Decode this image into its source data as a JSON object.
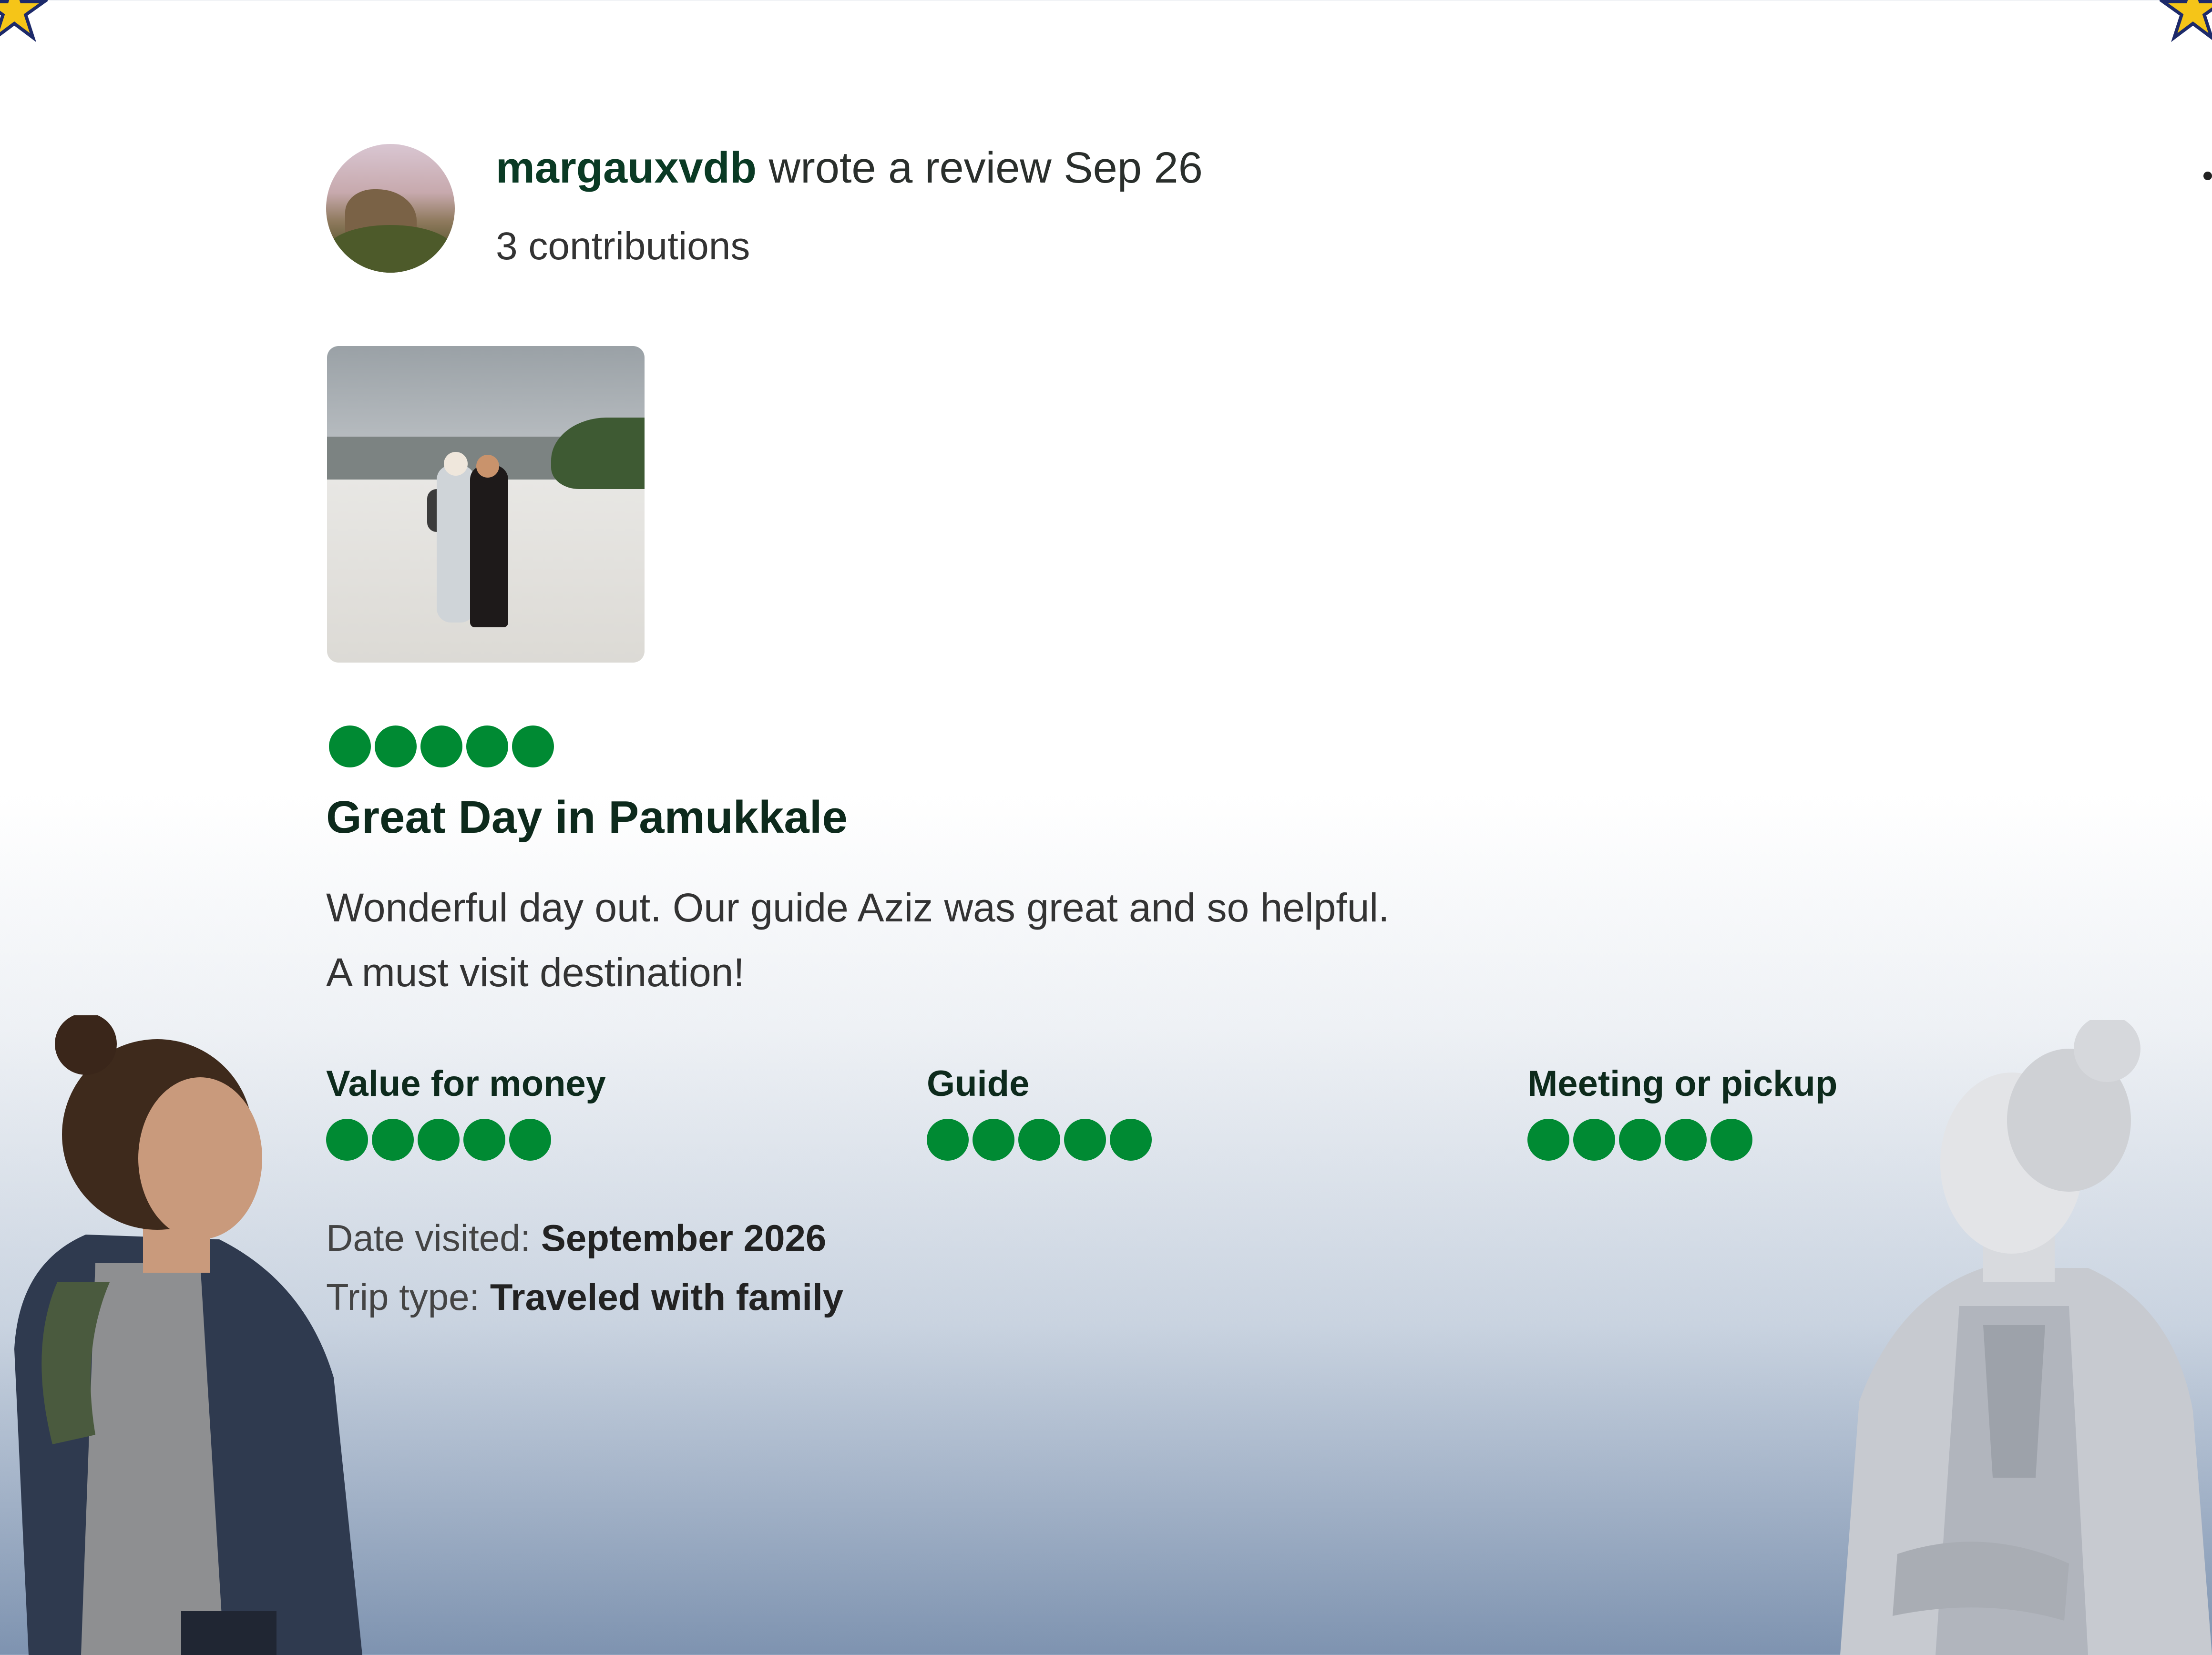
{
  "review": {
    "username": "margauxvdb",
    "action_text": "wrote a review Sep 26",
    "contributions": "3 contributions",
    "rating": 5,
    "title": "Great Day in Pamukkale",
    "body_lines": [
      "Wonderful day out. Our guide Aziz was great and so helpful.",
      "A must visit destination!"
    ],
    "subratings": [
      {
        "label": "Value for money",
        "rating": 5
      },
      {
        "label": "Guide",
        "rating": 5
      },
      {
        "label": "Meeting or pickup",
        "rating": 5
      }
    ],
    "date_visited_label": "Date visited:",
    "date_visited_value": "September 2026",
    "trip_type_label": "Trip type:",
    "trip_type_value": "Traveled with family"
  },
  "colors": {
    "bubble": "#008a33",
    "title": "#0d2a1c",
    "star": "#f5c518"
  },
  "icons": {
    "corner_left": "star-icon",
    "corner_right": "star-icon",
    "more": "more-options-icon"
  }
}
